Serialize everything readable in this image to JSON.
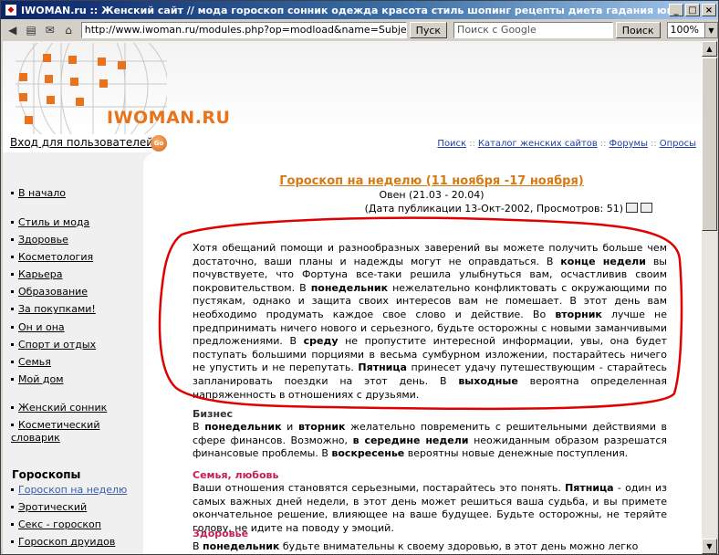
{
  "window": {
    "title": "IWOMAN.ru :: Женский сайт // мода гороскоп сонник одежда красота стиль шопинг рецепты диета гадания юмор же..."
  },
  "toolbar": {
    "url": "http://www.iwoman.ru/modules.php?op=modload&name=Subjects&fi",
    "go_label": "Пуск",
    "search_placeholder": "Поиск с Google",
    "search_button": "Поиск",
    "zoom": "100%"
  },
  "header": {
    "logo": "IWOMAN.RU",
    "login": "Вход для пользователей",
    "go": "Go"
  },
  "topnav": [
    "Поиск",
    "Каталог женских сайтов",
    "Форумы",
    "Опросы"
  ],
  "sidebar": {
    "group1": [
      "В начало"
    ],
    "group2": [
      "Стиль и мода",
      "Здоровье",
      "Косметология",
      "Карьера",
      "Образование",
      "За покупками!",
      "Он и она",
      "Спорт и отдых",
      "Семья",
      "Мой дом"
    ],
    "group3": [
      "Женский сонник",
      "Косметический словарик"
    ],
    "section_title": "Гороскопы",
    "group4": [
      "Гороскоп на неделю",
      "Эротический",
      "Секс - гороскоп",
      "Гороскоп друидов"
    ]
  },
  "article": {
    "title": "Гороскоп на неделю (11 ноября -17 ноября)",
    "subtitle": "Овен (21.03 - 20.04)",
    "meta": "(Дата публикации 13-Окт-2002, Просмотров: 51)",
    "p1": [
      "Хотя обещаний помощи и разнообразных заверений вы можете получить больше чем достаточно, ваши планы и надежды могут не оправдаться. В ",
      "конце недели",
      " вы почувствуете, что Фортуна все-таки решила улыбнуться вам, осчастливив своим покровительством. В ",
      "понедельник",
      " нежелательно конфликтовать с окружающими по пустякам, однако и защита своих интересов вам не помешает. В этот день вам необходимо продумать каждое свое слово и действие. Во ",
      "вторник",
      " лучше не предпринимать ничего нового и серьезного, будьте осторожны с новыми заманчивыми предложениями. В ",
      "среду",
      " не пропустите интересной информации, увы, она будет поступать большими порциями в весьма сумбурном изложении, постарайтесь ничего не упустить и не перепутать. ",
      "Пятница",
      " принесет удачу путешествующим - старайтесь запланировать поездки на этот день. В ",
      "выходные",
      " вероятна определенная напряженность в отношениях с друзьями."
    ],
    "business_title": "Бизнес",
    "p2": [
      "В ",
      "понедельник",
      " и ",
      "вторник",
      " желательно повременить с решительными действиями в сфере финансов. Возможно, ",
      "в середине недели",
      " неожиданным образом разрешатся финансовые проблемы. В ",
      "воскресенье",
      " вероятны новые денежные поступления."
    ],
    "family_title": "Семья, любовь",
    "p3": [
      "Ваши отношения становятся серьезными, постарайтесь это понять. ",
      "Пятница",
      " - один из самых важных дней недели, в этот день может решиться ваша судьба, и вы примете окончательное решение, влияющее на ваше будущее. Будьте осторожны, не теряйте голову, не идите на поводу у эмоций."
    ],
    "health_title": "Здоровье",
    "p4": [
      "В ",
      "понедельник",
      " будьте внимательны к своему здоровью, в этот день можно легко"
    ]
  }
}
